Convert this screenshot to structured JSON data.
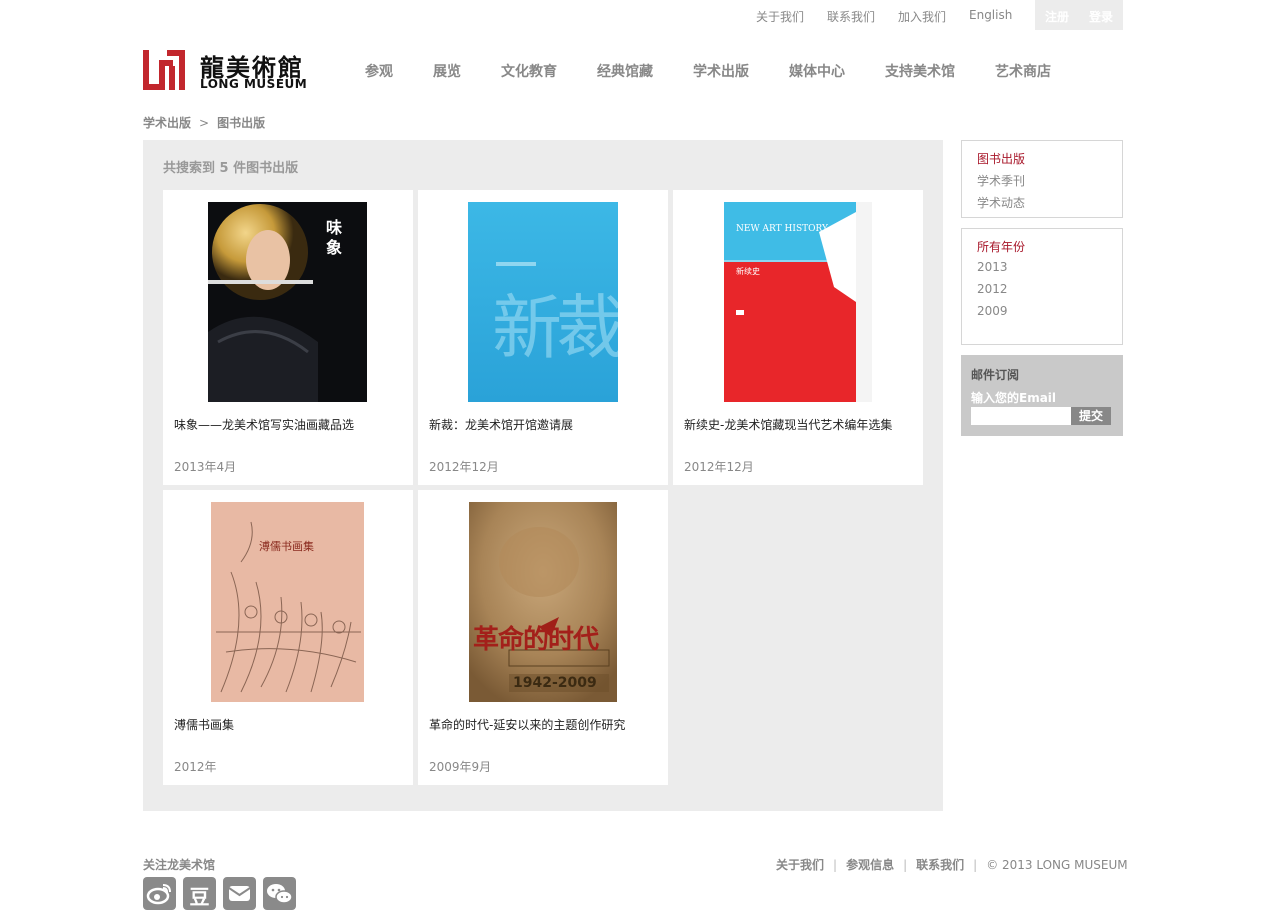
{
  "top_links": {
    "about": "关于我们",
    "contact": "联系我们",
    "join": "加入我们",
    "english": "English",
    "register": "注册",
    "login": "登录"
  },
  "logo": {
    "cn": "龍美術館",
    "en": "LONG MUSEUM",
    "brand_color": "#c2272d"
  },
  "nav": {
    "items": [
      "参观",
      "展览",
      "文化教育",
      "经典馆藏",
      "学术出版",
      "媒体中心",
      "支持美术馆",
      "艺术商店"
    ]
  },
  "breadcrumb": {
    "parent": "学术出版",
    "separator": ">",
    "current": "图书出版"
  },
  "results": {
    "count_text": "共搜索到 5 件图书出版"
  },
  "books": [
    {
      "title": "味象——龙美术馆写实油画藏品选",
      "date": "2013年4月",
      "cover_text": "味象"
    },
    {
      "title": "新裁：龙美术馆开馆邀请展",
      "date": "2012年12月",
      "cover_text": "新裁"
    },
    {
      "title": "新续史-龙美术馆藏现当代艺术编年选集",
      "date": "2012年12月",
      "cover_text": "NEW ART HISTORY",
      "cover_subtext": "新续史"
    },
    {
      "title": "溥儒书画集",
      "date": "2012年",
      "cover_text": "溥儒书画集"
    },
    {
      "title": "革命的时代-延安以来的主题创作研究",
      "date": "2009年9月",
      "cover_text": "革命的时代",
      "cover_subtext": "1942-2009"
    }
  ],
  "sidebar": {
    "categories": [
      "图书出版",
      "学术季刊",
      "学术动态"
    ],
    "years": [
      "所有年份",
      "2013",
      "2012",
      "2009"
    ],
    "active_color": "#a8172a"
  },
  "subscribe": {
    "title": "邮件订阅",
    "label": "输入您的Email",
    "placeholder": "",
    "button": "提交"
  },
  "footer": {
    "follow": "关注龙美术馆",
    "social_icons": [
      "weibo-icon",
      "douban-icon",
      "email-icon",
      "wechat-icon"
    ],
    "douban_glyph": "豆",
    "links": [
      "关于我们",
      "参观信息",
      "联系我们"
    ],
    "copyright": "© 2013 LONG MUSEUM"
  }
}
